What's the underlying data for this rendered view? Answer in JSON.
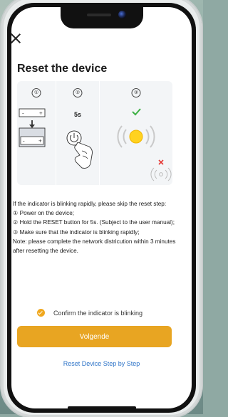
{
  "header": {
    "title": "Reset the device"
  },
  "illustration": {
    "steps": [
      {
        "number": "①"
      },
      {
        "number": "②",
        "timer": "5s"
      },
      {
        "number": "③"
      }
    ]
  },
  "instructions": {
    "lines": [
      "If the indicator is blinking rapidly, please skip the reset step:",
      "① Power on the device;",
      "② Hold the RESET button for 5s. (Subject to the user manual);",
      "③ Make sure that the indicator is blinking rapidly;",
      "Note: please complete the network districution within 3 minutes after resetting the device."
    ]
  },
  "confirm": {
    "label": "Confirm the indicator is blinking",
    "checked": true
  },
  "primary_button": {
    "label": "Volgende"
  },
  "link": {
    "label": "Reset Device Step by Step"
  },
  "colors": {
    "accent": "#e8a522",
    "link": "#2e74c8",
    "ok_green": "#3cb043",
    "error_red": "#e53935"
  },
  "icons": [
    "close-icon",
    "device-outlet-icon",
    "power-button-icon",
    "check-icon",
    "blinking-light-icon",
    "x-icon",
    "signal-icon",
    "checkmark-icon"
  ]
}
